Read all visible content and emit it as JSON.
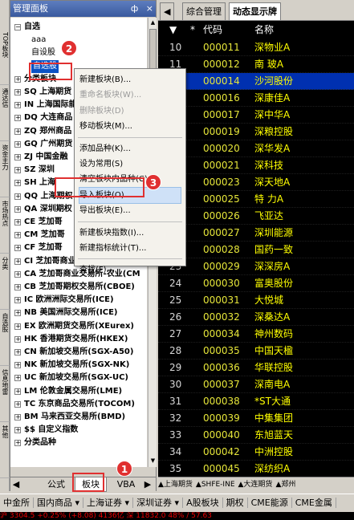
{
  "left_vertical_tabs": [
    "TOP板块",
    "通达信",
    "资金主力",
    "市场热点",
    "分类",
    "自选股",
    "信息地雷",
    "其他"
  ],
  "panel": {
    "title": "管理面板",
    "pin": "ф",
    "close": "×"
  },
  "tree": [
    {
      "box": "−",
      "label": "自选",
      "sub": false
    },
    {
      "box": "",
      "label": "aaa",
      "sub": true
    },
    {
      "box": "",
      "label": "自设股",
      "sub": true
    },
    {
      "box": "",
      "label": "自选股",
      "sub": true,
      "selected": true
    },
    {
      "box": "+",
      "label": "分类板块",
      "sub": false
    },
    {
      "box": "+",
      "label": "SQ 上海期货",
      "sub": false
    },
    {
      "box": "+",
      "label": "IN 上海国际能源",
      "sub": false
    },
    {
      "box": "+",
      "label": "DQ 大连商品",
      "sub": false
    },
    {
      "box": "+",
      "label": "ZQ 郑州商品",
      "sub": false
    },
    {
      "box": "+",
      "label": "GQ 广州期货",
      "sub": false
    },
    {
      "box": "+",
      "label": "ZJ 中国金融",
      "sub": false
    },
    {
      "box": "+",
      "label": "SZ 深圳",
      "sub": false
    },
    {
      "box": "+",
      "label": "SH 上海",
      "sub": false
    },
    {
      "box": "+",
      "label": "QQ 上海期权",
      "sub": false
    },
    {
      "box": "+",
      "label": "QA 深圳期权",
      "sub": false
    },
    {
      "box": "+",
      "label": "CE 芝加哥",
      "sub": false
    },
    {
      "box": "+",
      "label": "CM 芝加哥",
      "sub": false
    },
    {
      "box": "+",
      "label": "CF 芝加哥",
      "sub": false
    },
    {
      "box": "+",
      "label": "CI 芝加哥商业交易所-指数(CME)",
      "sub": false
    },
    {
      "box": "+",
      "label": "CA 芝加哥商业交易所-农业(CM",
      "sub": false
    },
    {
      "box": "+",
      "label": "CB 芝加哥期权交易所(CBOE)",
      "sub": false
    },
    {
      "box": "+",
      "label": "IC 欧洲洲际交易所(ICE)",
      "sub": false
    },
    {
      "box": "+",
      "label": "NB 美国洲际交易所(ICE)",
      "sub": false
    },
    {
      "box": "+",
      "label": "EX 欧洲期货交易所(XEurex)",
      "sub": false
    },
    {
      "box": "+",
      "label": "HK 香港期货交易所(HKEX)",
      "sub": false
    },
    {
      "box": "+",
      "label": "CN 新加坡交易所(SGX-A50)",
      "sub": false
    },
    {
      "box": "+",
      "label": "NK 新加坡交易所(SGX-NK)",
      "sub": false
    },
    {
      "box": "+",
      "label": "UC 新加坡交易所(SGX-UC)",
      "sub": false
    },
    {
      "box": "+",
      "label": "LM 伦敦金属交易所(LME)",
      "sub": false
    },
    {
      "box": "+",
      "label": "TC 东京商品交易所(TOCOM)",
      "sub": false
    },
    {
      "box": "+",
      "label": "BM 马来西亚交易所(BMD)",
      "sub": false
    },
    {
      "box": "+",
      "label": "$$ 自定义指数",
      "sub": false
    },
    {
      "box": "+",
      "label": "分类品种",
      "sub": false
    }
  ],
  "bottom_tabs": {
    "formula": "公式",
    "sector": "板块",
    "vba": "VBA"
  },
  "right_tabs": {
    "overview": "综合管理",
    "dynamic": "动态显示牌"
  },
  "table": {
    "headers": {
      "sort": "▼",
      "star": "*",
      "code": "代码",
      "name": "名称"
    },
    "rows": [
      {
        "no": "10",
        "code": "000011",
        "name": "深物业A"
      },
      {
        "no": "11",
        "code": "000012",
        "name": "南 玻A"
      },
      {
        "no": "12",
        "code": "000014",
        "name": "沙河股份",
        "highlight": true
      },
      {
        "no": "13",
        "code": "000016",
        "name": "深康佳A"
      },
      {
        "no": "14",
        "code": "000017",
        "name": "深中华A"
      },
      {
        "no": "15",
        "code": "000019",
        "name": "深粮控股"
      },
      {
        "no": "16",
        "code": "000020",
        "name": "深华发A"
      },
      {
        "no": "17",
        "code": "000021",
        "name": "深科技"
      },
      {
        "no": "18",
        "code": "000023",
        "name": "深天地A"
      },
      {
        "no": "19",
        "code": "000025",
        "name": "特 力A"
      },
      {
        "no": "20",
        "code": "000026",
        "name": "飞亚达"
      },
      {
        "no": "21",
        "code": "000027",
        "name": "深圳能源"
      },
      {
        "no": "22",
        "code": "000028",
        "name": "国药一致"
      },
      {
        "no": "23",
        "code": "000029",
        "name": "深深房A"
      },
      {
        "no": "24",
        "code": "000030",
        "name": "富奥股份"
      },
      {
        "no": "25",
        "code": "000031",
        "name": "大悦城"
      },
      {
        "no": "26",
        "code": "000032",
        "name": "深桑达A"
      },
      {
        "no": "27",
        "code": "000034",
        "name": "神州数码"
      },
      {
        "no": "28",
        "code": "000035",
        "name": "中国天楹"
      },
      {
        "no": "29",
        "code": "000036",
        "name": "华联控股"
      },
      {
        "no": "30",
        "code": "000037",
        "name": "深南电A"
      },
      {
        "no": "31",
        "code": "000038",
        "name": "*ST大通"
      },
      {
        "no": "32",
        "code": "000039",
        "name": "中集集团"
      },
      {
        "no": "33",
        "code": "000040",
        "name": "东旭蓝天"
      },
      {
        "no": "34",
        "code": "000042",
        "name": "中洲控股"
      },
      {
        "no": "35",
        "code": "000045",
        "name": "深纺织A"
      }
    ]
  },
  "right_bottom_tabs": [
    "▲上海期货",
    "▲SHFE-INE",
    "▲大连期货",
    "▲郑州"
  ],
  "bottom_bar": [
    "中金所",
    "国内商品 ▾",
    "上海证券 ▾",
    "深圳证券 ▾",
    "A股板块",
    "期权",
    "CME能源",
    "CME金属"
  ],
  "status_text": "沪 3304.5 +0.25% (+8.08) 4136亿    深 11832.0 48% / 57.63",
  "menu": {
    "items": [
      {
        "label": "新建板块(B)...",
        "disabled": false
      },
      {
        "label": "重命名板块(W)...",
        "disabled": true
      },
      {
        "label": "删除板块(D)",
        "disabled": true
      },
      {
        "label": "移动板块(M)...",
        "disabled": false
      },
      {
        "sep": true
      },
      {
        "label": "添加品种(K)...",
        "disabled": false
      },
      {
        "label": "设为常用(S)",
        "disabled": false
      },
      {
        "label": "清空板块内品种(C)",
        "disabled": false
      },
      {
        "label": "导入板块(O)...",
        "disabled": false,
        "hover": true
      },
      {
        "label": "导出板块(E)...",
        "disabled": false
      },
      {
        "sep": true
      },
      {
        "label": "新建板块指数(I)...",
        "disabled": false
      },
      {
        "label": "新建指标统计(T)...",
        "disabled": false
      },
      {
        "sep": true
      },
      {
        "label": "查找(F)...",
        "disabled": false
      }
    ]
  },
  "badges": [
    "1",
    "2",
    "3"
  ]
}
